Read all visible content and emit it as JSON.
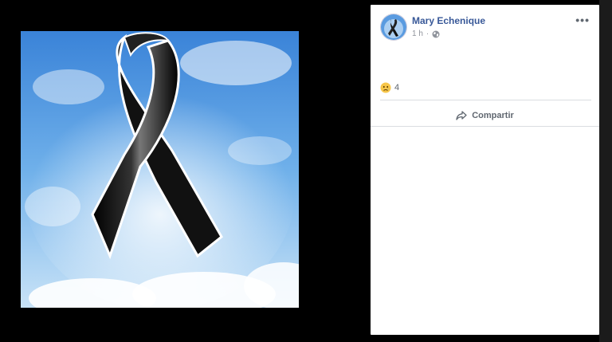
{
  "post": {
    "author": "Mary Echenique",
    "time": "1 h",
    "privacy_icon": "globe-icon",
    "more_label": "•••"
  },
  "reactions": {
    "icon": "sad-face-icon",
    "count": "4"
  },
  "actions": {
    "share_label": "Compartir",
    "share_icon": "share-arrow-icon"
  },
  "colors": {
    "author_link": "#385898",
    "meta_text": "#90949c",
    "viewer_bg": "#000000"
  }
}
